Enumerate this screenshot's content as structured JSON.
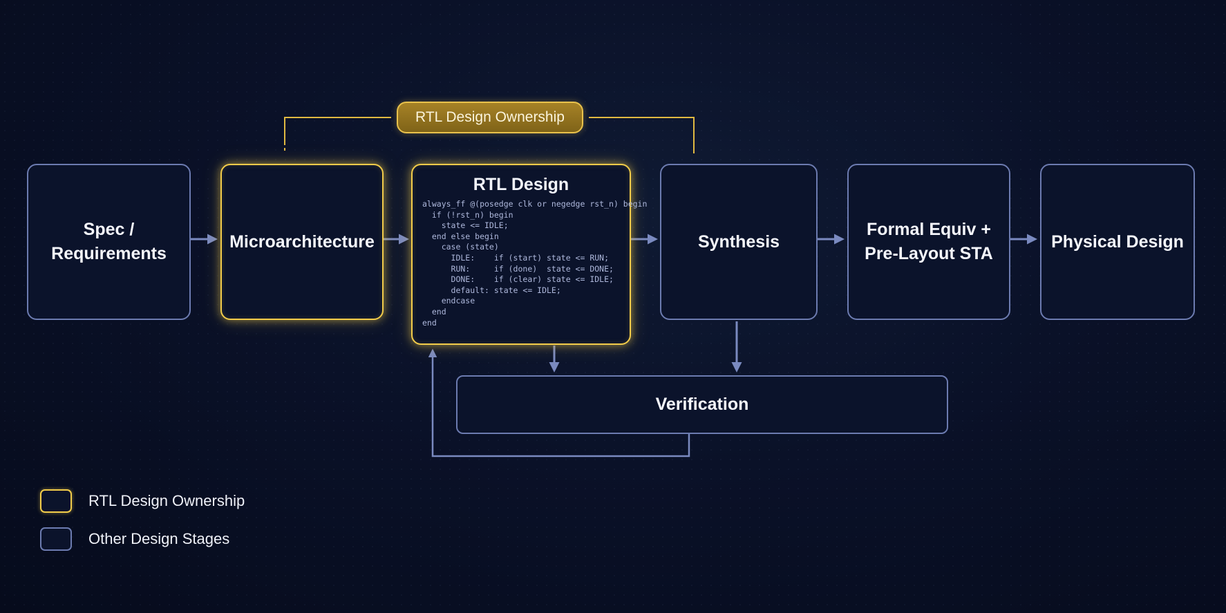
{
  "ownership_banner": "RTL Design Ownership",
  "stages": {
    "spec": "Spec /\nRequirements",
    "microarchitecture": "Microarchitecture",
    "rtl_design": "RTL Design",
    "synthesis": "Synthesis",
    "formal_sta": "Formal Equiv +\nPre-Layout STA",
    "physical_design": "Physical Design",
    "verification": "Verification"
  },
  "rtl_code": [
    "always_ff @(posedge clk or negedge rst_n) begin",
    "  if (!rst_n) begin",
    "    state <= IDLE;",
    "  end else begin",
    "    case (state)",
    "      IDLE:    if (start) state <= RUN;",
    "      RUN:     if (done)  state <= DONE;",
    "      DONE:    if (clear) state <= IDLE;",
    "      default: state <= IDLE;",
    "    endcase",
    "  end",
    "end"
  ],
  "legend": [
    {
      "label": "RTL Design Ownership",
      "kind": "owned"
    },
    {
      "label": "Other Design Stages",
      "kind": "other"
    }
  ],
  "colors": {
    "background": "#0a1128",
    "box_border": "#6c7bb0",
    "ownership_accent": "#f2cc4a",
    "arrow": "#6c7bb0"
  }
}
